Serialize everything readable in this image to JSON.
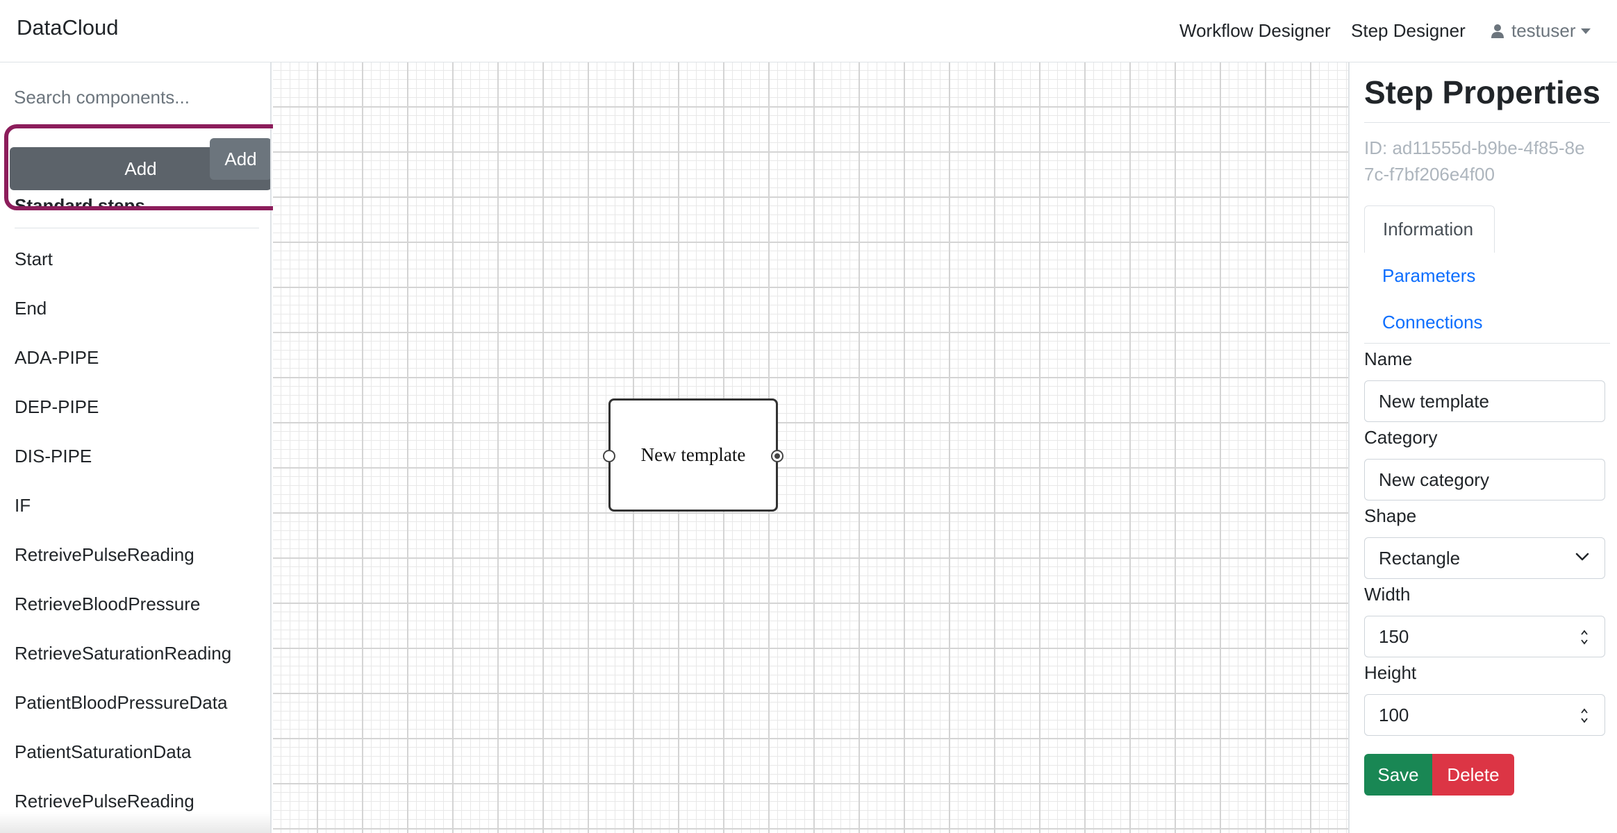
{
  "navbar": {
    "brand": "DataCloud",
    "links": [
      "Workflow Designer",
      "Step Designer"
    ],
    "user": "testuser"
  },
  "sidebar": {
    "search_placeholder": "Search components...",
    "add_button": "Add",
    "section_title": "Standard steps",
    "hover_add_button": "Add",
    "steps": [
      "Start",
      "End",
      "ADA-PIPE",
      "DEP-PIPE",
      "DIS-PIPE",
      "IF",
      "RetreivePulseReading",
      "RetrieveBloodPressure",
      "RetrieveSaturationReading",
      "PatientBloodPressureData",
      "PatientSaturationData",
      "RetrievePulseReading"
    ]
  },
  "canvas": {
    "node_label": "New template"
  },
  "panel": {
    "title": "Step Properties",
    "id_text": "ID: ad11555d-b9be-4f85-8e7c-f7bf206e4f00",
    "tabs": [
      "Information",
      "Parameters",
      "Connections"
    ],
    "active_tab": "Information",
    "fields": {
      "name_label": "Name",
      "name_value": "New template",
      "category_label": "Category",
      "category_value": "New category",
      "shape_label": "Shape",
      "shape_value": "Rectangle",
      "width_label": "Width",
      "width_value": "150",
      "height_label": "Height",
      "height_value": "100"
    },
    "save_label": "Save",
    "delete_label": "Delete"
  },
  "colors": {
    "highlight": "#8c1d5b",
    "save": "#198754",
    "delete": "#dc3545",
    "link": "#0d6efd",
    "secondary": "#6c757d"
  },
  "icons": [
    "user-icon",
    "caret-down-icon",
    "chevron-down-icon",
    "spinner-icon",
    "arrow-annotation-icon"
  ]
}
